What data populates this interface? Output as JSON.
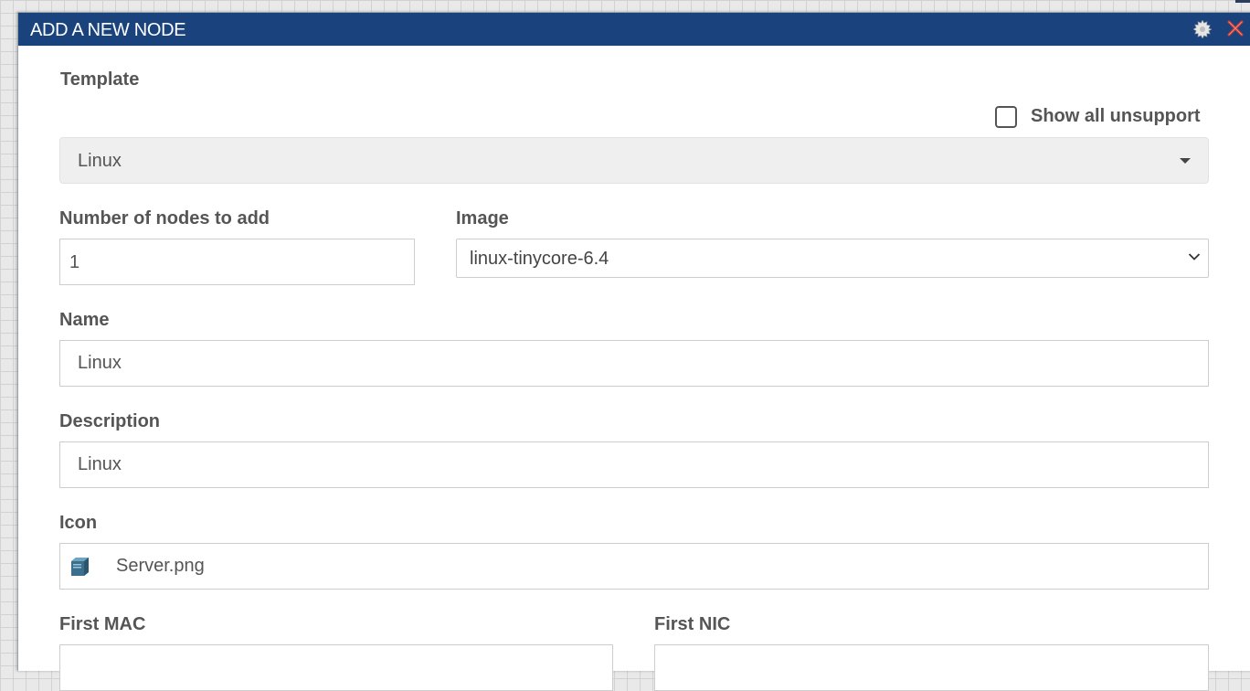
{
  "dialog": {
    "title": "ADD A NEW NODE",
    "gear_icon": "gear-icon",
    "close_icon": "close-icon"
  },
  "template": {
    "label": "Template",
    "show_unsupported_label": "Show all unsupport",
    "show_unsupported_checked": false,
    "selected": "Linux"
  },
  "nodes_count": {
    "label": "Number of nodes to add",
    "value": "1"
  },
  "image": {
    "label": "Image",
    "selected": "linux-tinycore-6.4"
  },
  "name": {
    "label": "Name",
    "value": "Linux"
  },
  "description": {
    "label": "Description",
    "value": "Linux"
  },
  "icon": {
    "label": "Icon",
    "value": "Server.png",
    "icon_name": "server-icon"
  },
  "first_mac": {
    "label": "First MAC"
  },
  "first_nic": {
    "label": "First NIC"
  },
  "colors": {
    "titlebar": "#1a437e",
    "close": "#c0392b",
    "label": "#555555"
  }
}
